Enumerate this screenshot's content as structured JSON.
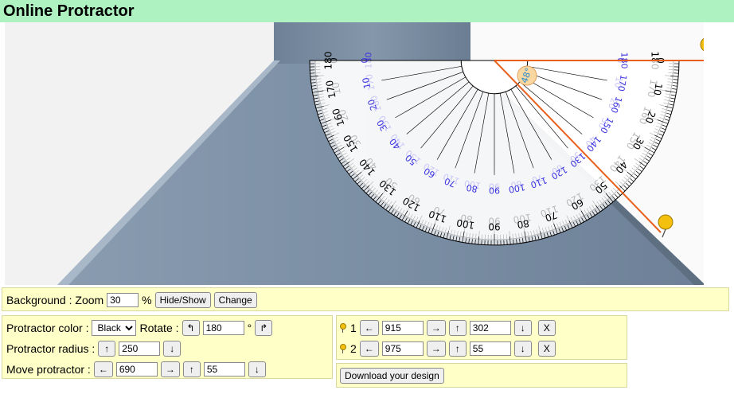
{
  "header": {
    "title": "Online Protractor"
  },
  "protractor": {
    "outer_labels": [
      "0",
      "10",
      "20",
      "30",
      "40",
      "50",
      "60",
      "70",
      "80",
      "90",
      "100",
      "110",
      "120",
      "130",
      "140",
      "150",
      "160",
      "170",
      "180"
    ],
    "inner_labels": [
      "180",
      "170",
      "160",
      "150",
      "140",
      "130",
      "120",
      "110",
      "100",
      "90",
      "80",
      "70",
      "60",
      "50",
      "40",
      "30",
      "20",
      "10",
      "0"
    ],
    "angle_badge": "48°",
    "colors": {
      "accent": "#e8601c",
      "inner_label": "#3a32e0",
      "pin": "#f3c00d",
      "badge": "#f8d8a0",
      "surface": "#7f93a8"
    }
  },
  "background_panel": {
    "label": "Background : Zoom",
    "zoom_value": "30",
    "percent": "%",
    "hide_show": "Hide/Show",
    "change": "Change"
  },
  "controls": {
    "color_label": "Protractor color :",
    "color_value": "Black",
    "color_options": [
      "Black"
    ],
    "rotate_label": "Rotate :",
    "rotate_left": "↰",
    "rotate_value": "180",
    "degree": "°",
    "rotate_right": "↱",
    "radius_label": "Protractor radius :",
    "radius_up": "↑",
    "radius_value": "250",
    "radius_down": "↓",
    "move_label": "Move protractor :",
    "move_left": "←",
    "move_x": "690",
    "move_right": "→",
    "move_up": "↑",
    "move_y": "55",
    "move_down": "↓"
  },
  "pins": [
    {
      "num": "1",
      "left": "←",
      "x": "915",
      "right": "→",
      "up": "↑",
      "y": "302",
      "down": "↓",
      "remove": "X"
    },
    {
      "num": "2",
      "left": "←",
      "x": "975",
      "right": "→",
      "up": "↑",
      "y": "55",
      "down": "↓",
      "remove": "X"
    }
  ],
  "download": {
    "label": "Download your design"
  }
}
